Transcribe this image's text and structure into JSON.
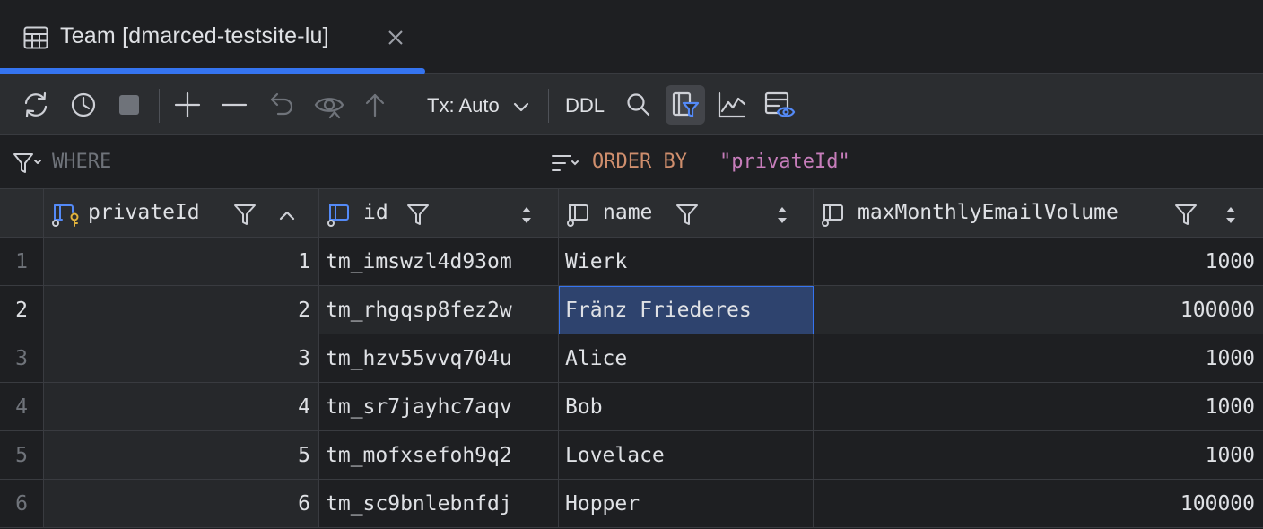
{
  "tab": {
    "title": "Team [dmarced-testsite-lu]",
    "icon": "table-icon",
    "accent_color": "#3574f0"
  },
  "toolbar": {
    "buttons": [
      "reload-icon",
      "history-icon",
      "stop-icon",
      "add-row-icon",
      "delete-row-icon",
      "revert-icon",
      "preview-changes-icon",
      "submit-icon",
      "search-icon",
      "filter-panel-icon",
      "chart-icon",
      "view-options-icon"
    ],
    "transaction_label": "Tx: Auto",
    "ddl_label": "DDL"
  },
  "filter": {
    "where_label": "WHERE",
    "order_keyword": "ORDER BY ",
    "order_value": "\"privateId\""
  },
  "columns": [
    {
      "name": "privateId",
      "icon": "primary-key-column-icon",
      "sort": "ascending"
    },
    {
      "name": "id",
      "icon": "unique-column-icon",
      "sort": "none"
    },
    {
      "name": "name",
      "icon": "column-icon",
      "sort": "none"
    },
    {
      "name": "maxMonthlyEmailVolume",
      "icon": "column-icon",
      "sort": "none"
    }
  ],
  "rows": [
    {
      "num": "1",
      "privateId": "1",
      "id": "tm_imswzl4d93om",
      "name": "Wierk",
      "maxMonthlyEmailVolume": "1000"
    },
    {
      "num": "2",
      "privateId": "2",
      "id": "tm_rhgqsp8fez2w",
      "name": "Fränz Friederes",
      "maxMonthlyEmailVolume": "100000"
    },
    {
      "num": "3",
      "privateId": "3",
      "id": "tm_hzv55vvq704u",
      "name": "Alice",
      "maxMonthlyEmailVolume": "1000"
    },
    {
      "num": "4",
      "privateId": "4",
      "id": "tm_sr7jayhc7aqv",
      "name": "Bob",
      "maxMonthlyEmailVolume": "1000"
    },
    {
      "num": "5",
      "privateId": "5",
      "id": "tm_mofxsefoh9q2",
      "name": "Lovelace",
      "maxMonthlyEmailVolume": "1000"
    },
    {
      "num": "6",
      "privateId": "6",
      "id": "tm_sc9bnlebnfdj",
      "name": "Hopper",
      "maxMonthlyEmailVolume": "100000"
    }
  ],
  "selection": {
    "row": 2,
    "column": "name"
  }
}
